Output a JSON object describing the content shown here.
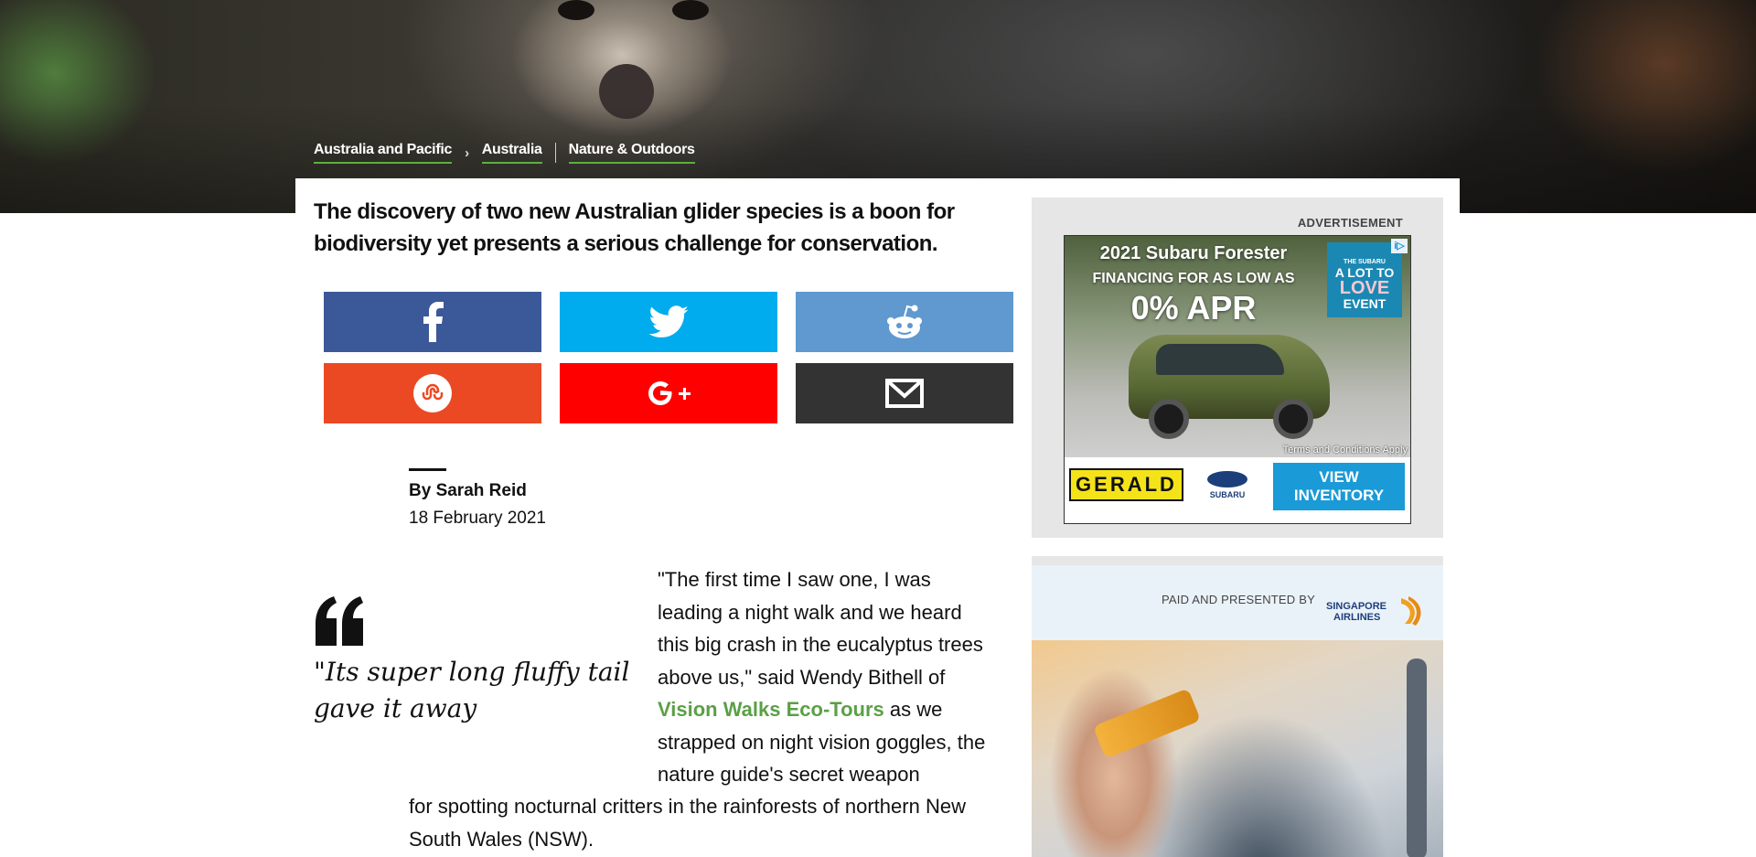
{
  "breadcrumb": {
    "items": [
      "Australia and Pacific",
      "Australia",
      "Nature & Outdoors"
    ]
  },
  "article": {
    "headline": "The discovery of two new Australian glider species is a boon for biodiversity yet presents a serious challenge for conservation.",
    "byline": "By Sarah Reid",
    "date": "18 February 2021",
    "pull_quote": "\"Its super long fluffy tail gave it away",
    "paragraph": {
      "before_link": "\"The first time I saw one, I was leading a night walk and we heard this big crash in the eucalyptus trees above us,\" said Wendy Bithell of ",
      "link_text": "Vision Walks Eco-Tours",
      "after_link": " as we strapped on night vision goggles, the nature guide's secret weapon",
      "continued": "for spotting nocturnal critters in the rainforests of northern New South Wales (NSW)."
    }
  },
  "share": {
    "buttons": [
      {
        "icon": "facebook-icon",
        "color": "#3b5998"
      },
      {
        "icon": "twitter-icon",
        "color": "#00aced"
      },
      {
        "icon": "reddit-icon",
        "color": "#5f99cf"
      },
      {
        "icon": "stumbleupon-icon",
        "color": "#eb4924"
      },
      {
        "icon": "google-plus-icon",
        "color": "#ff0000"
      },
      {
        "icon": "email-icon",
        "color": "#333333"
      }
    ]
  },
  "ad": {
    "label": "ADVERTISEMENT",
    "title": "2021 Subaru Forester",
    "financing": "FINANCING FOR AS LOW AS",
    "apr": "0% APR",
    "badge_small": "THE SUBARU",
    "badge_line1": "A LOT TO",
    "badge_line2": "LOVE",
    "badge_line3": "EVENT",
    "choices": "i▷",
    "terms": "Terms and Conditions Apply",
    "dealer": "GERALD",
    "brand": "SUBARU",
    "cta": "VIEW INVENTORY"
  },
  "sponsor": {
    "label": "PAID AND PRESENTED BY",
    "brand_line1": "SINGAPORE",
    "brand_line2": "AIRLINES"
  },
  "colors": {
    "accent_green": "#5aa046",
    "ad_background": "#e6e6e6"
  }
}
